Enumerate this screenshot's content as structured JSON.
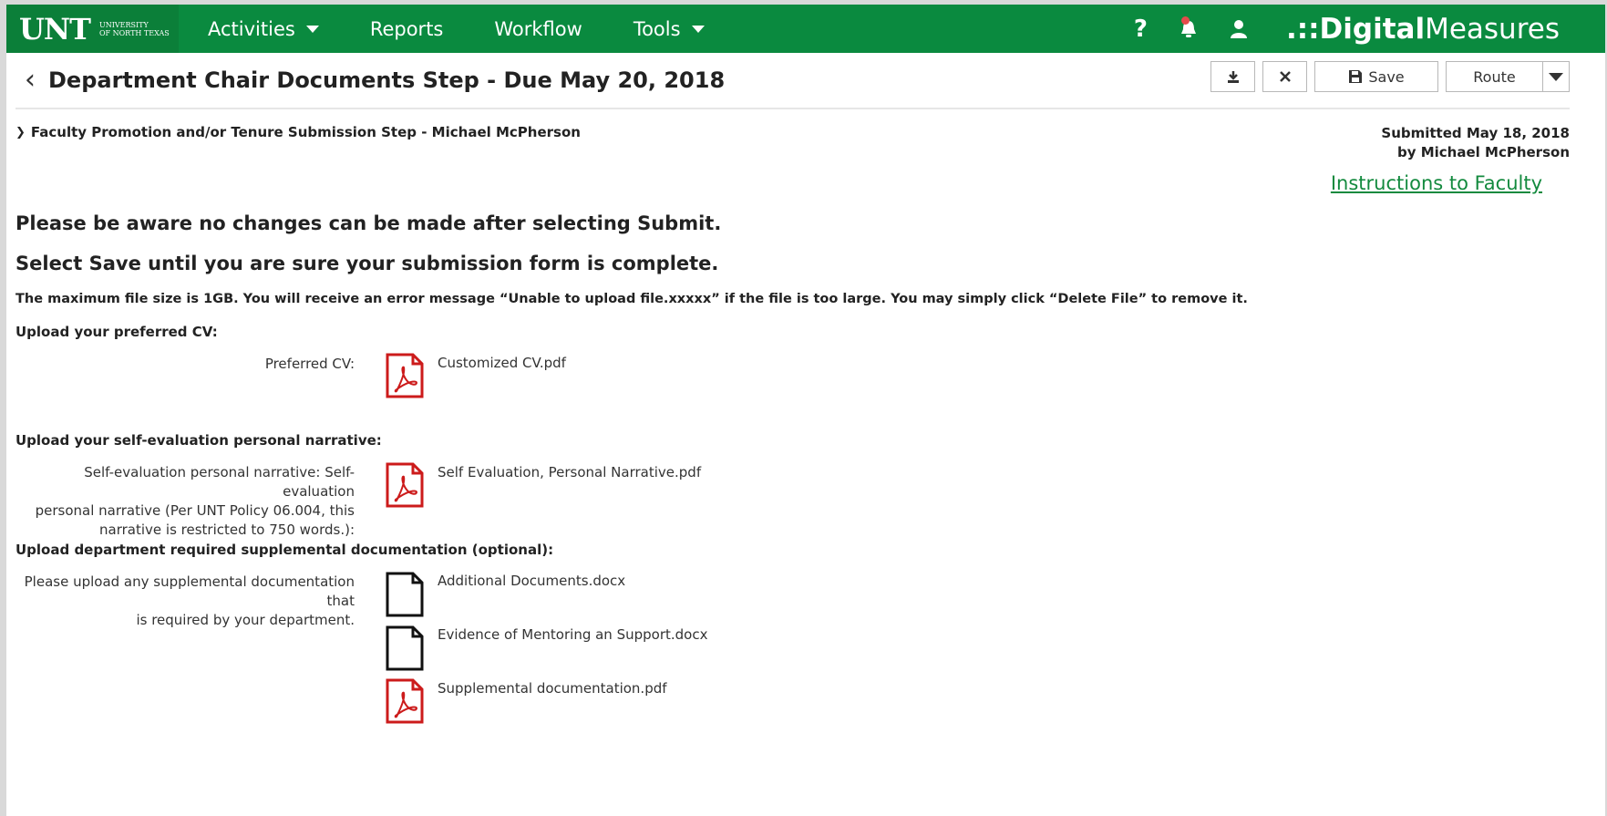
{
  "brand": {
    "logo": "UNT",
    "sub_line1": "UNIVERSITY",
    "sub_line2": "OF NORTH TEXAS"
  },
  "nav": {
    "activities": "Activities",
    "reports": "Reports",
    "workflow": "Workflow",
    "tools": "Tools"
  },
  "top_right": {
    "help": "?",
    "logo_prefix": ".::",
    "logo_bold": "Digital",
    "logo_light": "Measures"
  },
  "header": {
    "back": "‹",
    "title": "Department Chair Documents Step - Due May 20, 2018",
    "save_label": "Save",
    "route_label": "Route"
  },
  "submission": {
    "step": "Faculty Promotion and/or Tenure Submission Step - Michael McPherson",
    "submitted_line1": "Submitted May 18, 2018",
    "submitted_line2": "by Michael McPherson",
    "instructions_link": "Instructions to Faculty"
  },
  "messages": {
    "warning1": "Please be aware no changes can be made after selecting Submit.",
    "warning2": "Select Save until you are sure your submission form is complete.",
    "file_note": "The maximum file size is 1GB. You will receive an error message “Unable to upload file.xxxxx” if the file is too large. You may simply click “Delete File” to remove it."
  },
  "sections": {
    "cv": {
      "heading": "Upload your preferred CV:",
      "label": "Preferred CV:",
      "files": [
        {
          "name": "Customized CV.pdf",
          "type": "pdf"
        }
      ]
    },
    "narrative": {
      "heading": "Upload your self-evaluation personal narrative:",
      "label_line1": "Self-evaluation personal narrative: Self-evaluation",
      "label_line2": "personal narrative (Per UNT Policy 06.004, this",
      "label_line3": "narrative is restricted to 750 words.):",
      "files": [
        {
          "name": "Self Evaluation, Personal Narrative.pdf",
          "type": "pdf"
        }
      ]
    },
    "supplemental": {
      "heading": "Upload department required supplemental documentation (optional):",
      "label_line1": "Please upload any supplemental documentation that",
      "label_line2": "is required by your department.",
      "files": [
        {
          "name": "Additional Documents.docx",
          "type": "docx"
        },
        {
          "name": "Evidence of Mentoring an Support.docx",
          "type": "docx"
        },
        {
          "name": "Supplemental documentation.pdf",
          "type": "pdf"
        }
      ]
    }
  },
  "colors": {
    "brand_green": "#0a8a3f",
    "link_green": "#138a3e",
    "pdf_red": "#cc1b1b"
  }
}
